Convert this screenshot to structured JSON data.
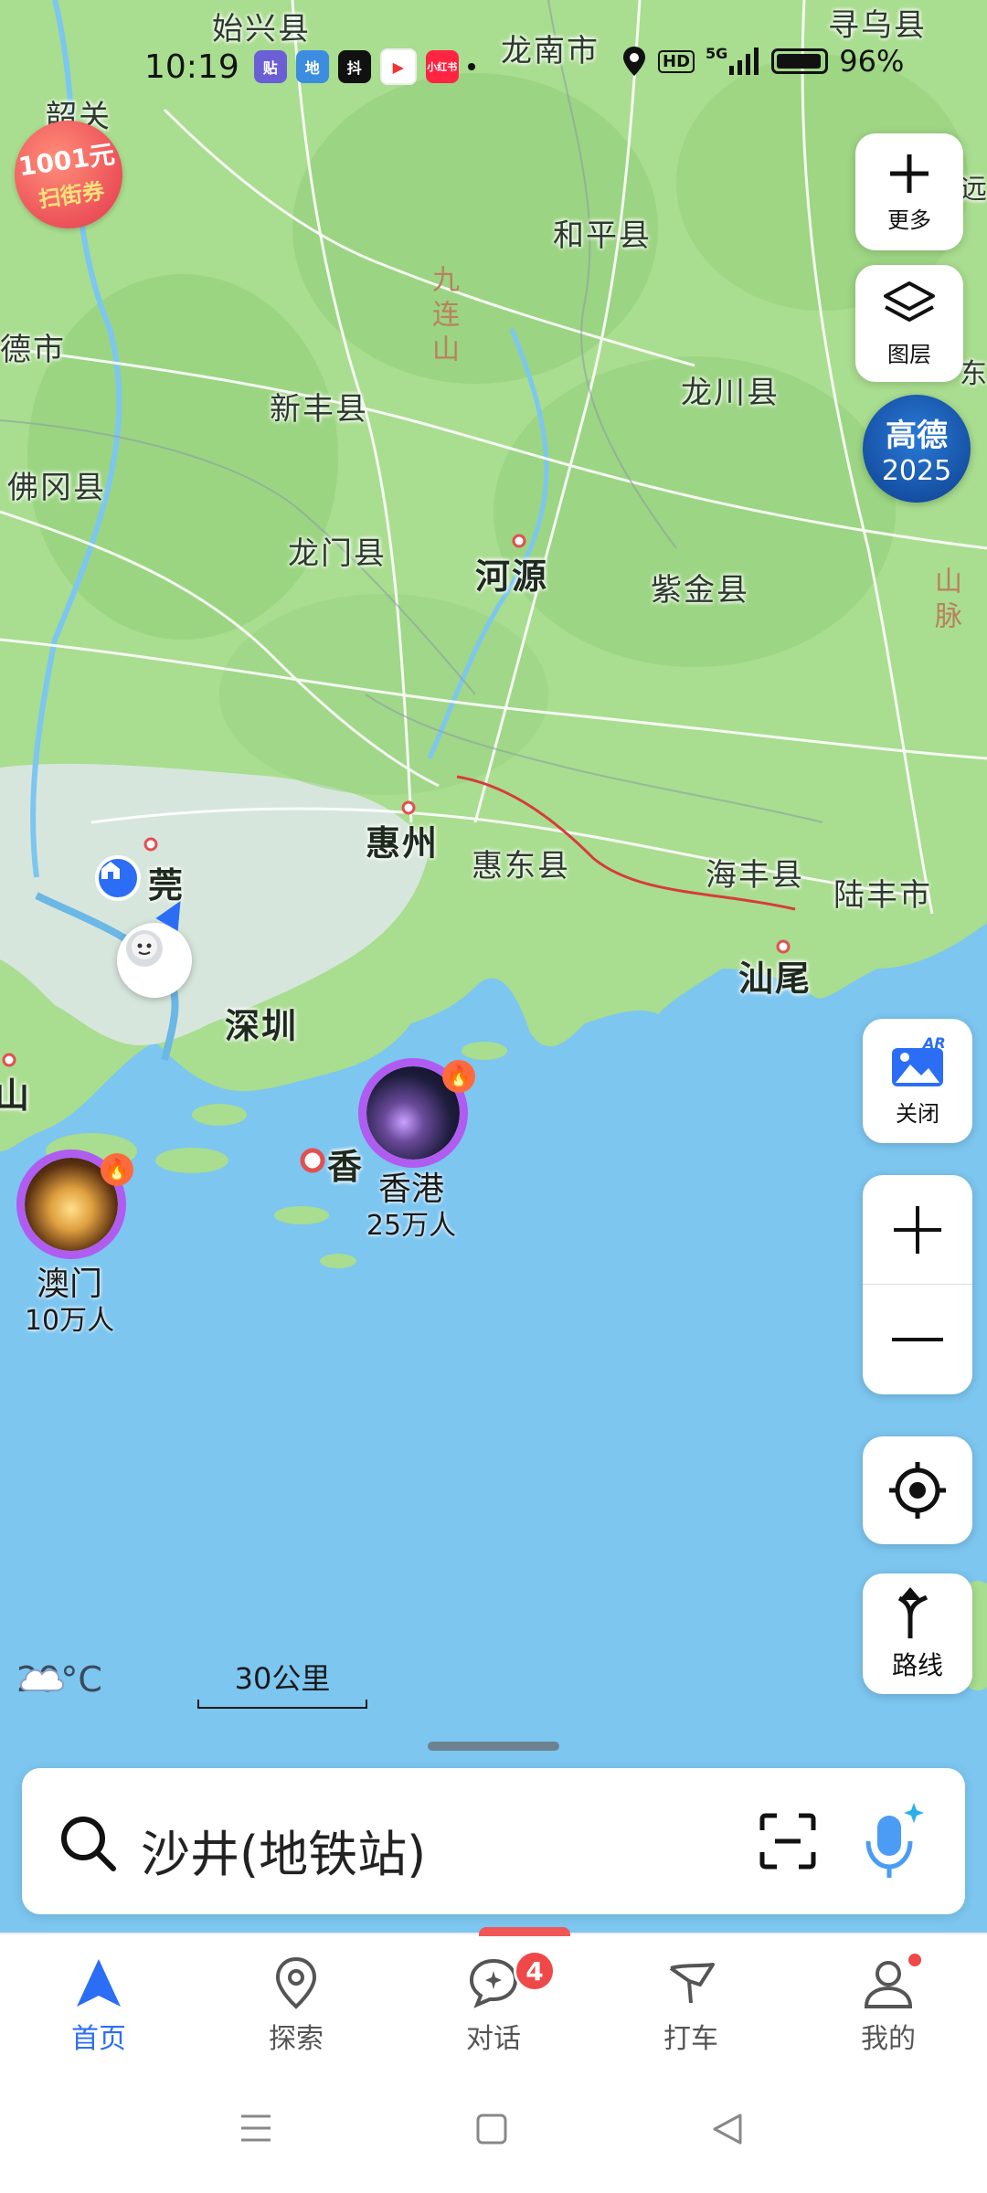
{
  "status_bar": {
    "time": "10:19",
    "network": "5G",
    "hd": "HD",
    "battery": "96%",
    "app_icons": [
      "贴",
      "地",
      "抖",
      "▶",
      "小红书"
    ]
  },
  "map": {
    "places": [
      {
        "name": "始兴县"
      },
      {
        "name": "龙南市"
      },
      {
        "name": "寻乌县"
      },
      {
        "name": "韶关"
      },
      {
        "name": "和平县"
      },
      {
        "name": "德市"
      },
      {
        "name": "新丰县"
      },
      {
        "name": "龙川县"
      },
      {
        "name": "佛冈县"
      },
      {
        "name": "龙门县"
      },
      {
        "name": "河源"
      },
      {
        "name": "紫金县"
      },
      {
        "name": "惠州"
      },
      {
        "name": "惠东县"
      },
      {
        "name": "海丰县"
      },
      {
        "name": "陆丰市"
      },
      {
        "name": "莞"
      },
      {
        "name": "汕尾"
      },
      {
        "name": "深圳"
      },
      {
        "name": "山"
      },
      {
        "name": "香"
      }
    ],
    "mountains": [
      "九连山",
      "山脉"
    ],
    "promo_badge": {
      "amount": "1001元",
      "text": "扫街券"
    },
    "brand_badge": {
      "line1": "高德",
      "line2": "2025"
    },
    "right_edge_text": [
      "远",
      "东"
    ],
    "markers": [
      {
        "name": "香港",
        "count": "25万人"
      },
      {
        "name": "澳门",
        "count": "10万人"
      }
    ],
    "weather": {
      "temp": "29°C"
    },
    "scale": "30公里"
  },
  "controls": {
    "more": "更多",
    "layers": "图层",
    "ar": "关闭",
    "route": "路线"
  },
  "search": {
    "value": "沙井(地铁站)"
  },
  "tabs": [
    {
      "label": "首页",
      "active": true
    },
    {
      "label": "探索"
    },
    {
      "label": "对话",
      "badge": "4"
    },
    {
      "label": "打车"
    },
    {
      "label": "我的"
    }
  ],
  "colors": {
    "accent": "#2b6ef5",
    "sea": "#7cc6f0",
    "land": "#a9dd8f",
    "marker_ring": "#b05cf0"
  }
}
